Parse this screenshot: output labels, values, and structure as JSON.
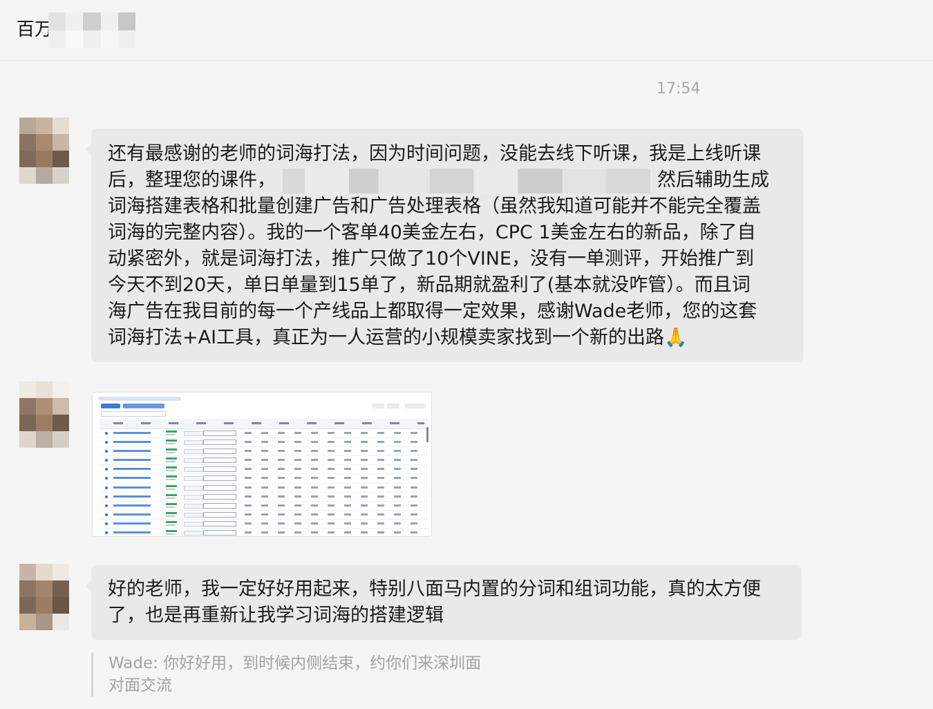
{
  "header": {
    "title": "百万"
  },
  "timestamp": "17:54",
  "messages": [
    {
      "lines": [
        "还有最感谢的老师的词海打法，因为时间问题，没能去线下听课，我是上线听课",
        "后，整理您的课件，",
        "然后辅助生成",
        "词海搭建表格和批量创建广告和广告处理表格（虽然我知道可能并不能完全覆盖",
        "词海的完整内容）。我的一个客单40美金左右，CPC 1美金左右的新品，除了自",
        "动紧密外，就是词海打法，推广只做了10个VINE，没有一单测评，开始推广到",
        "今天不到20天，单日单量到15单了，新品期就盈利了(基本就没咋管）。而且词",
        "海广告在我目前的每一个产线品上都取得一定效果，感谢Wade老师，您的这套",
        "词海打法+AI工具，真正为一人运营的小规模卖家找到一个新的出路"
      ],
      "emoji": "🙏"
    },
    {
      "lines": [
        "好的老师，我一定好好用起来，特别八面马内置的分词和组词功能，真的太方便",
        "了，也是再重新让我学习词海的搭建逻辑"
      ]
    }
  ],
  "quote": {
    "lines": [
      "Wade: 你好好用，到时候内侧结束，约你们来深圳面",
      "对面交流"
    ]
  }
}
